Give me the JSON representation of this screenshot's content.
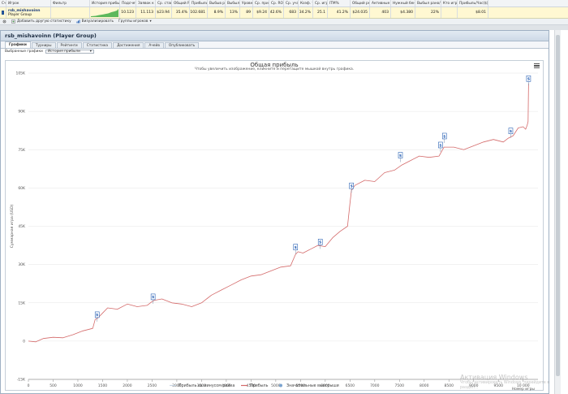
{
  "grid": {
    "headers": [
      "Сч.",
      "Игрок",
      "Фильтр",
      "История прибыли",
      "Подсчет",
      "Заявок к учас",
      "Ср. ставка",
      "Общий ROI",
      "Прибыль (",
      "Выбыв рано",
      "Выбыл поз",
      "Уровни",
      "Ср. прибыл",
      "Ср. ROI",
      "Ср. участ",
      "Коэф. тур",
      "Ср. игры ,",
      "ITM%",
      "Общий рейт",
      "Активные д",
      "Нужный бенкрол",
      "Выбыл рано/средне",
      "Кто играл",
      "Прибыль/Час($)"
    ],
    "row": {
      "player_name": "rsb_mishavoinn",
      "player_group": "Player Group",
      "values": [
        "10.123",
        "11.113",
        "$23.94",
        "35.4%",
        "$102.681",
        "8.9%",
        "13%",
        "89",
        "$9.24",
        "42.6%",
        "683",
        "34.2%",
        "25.1",
        "41.2%",
        "$24.035",
        "403",
        "$4.380",
        "22%",
        "",
        "$8.01"
      ]
    }
  },
  "toolbar": {
    "add_stats": "Добавить другую статистику",
    "visualize": "Визуализировать",
    "player_groups": "Группы игроков"
  },
  "panel": {
    "title": "rsb_mishavoinn (Player Group)",
    "tabs": [
      "Графики",
      "Турниры",
      "Рейтинги",
      "Статистика",
      "Достижения",
      "Ачейв",
      "Опубликовать"
    ],
    "selected_graph_label": "Выбранные графики",
    "selected_graph_value": "История прибыли"
  },
  "chart_data": {
    "type": "line",
    "title": "Общая прибыль",
    "subtitle": "Чтобы увеличить изображение, кликните и перетащите мышкой внутрь графика.",
    "ylabel": "Суммарная игра (USD)",
    "xlabel": "Номер игры",
    "xlim": [
      0,
      10300
    ],
    "ylim": [
      -15000,
      105000
    ],
    "x_ticks": [
      "0",
      "500",
      "1000",
      "1500",
      "2000",
      "2500",
      "3000",
      "3500",
      "4000",
      "4500",
      "5000",
      "5500",
      "6000",
      "6500",
      "7000",
      "7500",
      "8000",
      "8500",
      "9000",
      "9500",
      "10 000"
    ],
    "y_ticks": [
      "-15K",
      "0",
      "15K",
      "30K",
      "45K",
      "60K",
      "75K",
      "90K",
      "105K"
    ],
    "series": [
      {
        "name": "Прибыль",
        "color": "#d46a6a",
        "x": [
          0,
          150,
          300,
          500,
          700,
          900,
          1100,
          1300,
          1350,
          1400,
          1600,
          1800,
          2000,
          2200,
          2400,
          2500,
          2550,
          2700,
          2900,
          3100,
          3300,
          3500,
          3700,
          3900,
          4100,
          4300,
          4500,
          4700,
          4900,
          5100,
          5300,
          5400,
          5450,
          5550,
          5700,
          5850,
          6000,
          6150,
          6300,
          6450,
          6500,
          6530,
          6600,
          6800,
          7000,
          7200,
          7400,
          7550,
          7700,
          7900,
          8100,
          8300,
          8400,
          8600,
          8800,
          9000,
          9200,
          9400,
          9600,
          9700,
          9800,
          9900,
          10000,
          10050,
          10080,
          10100,
          10110
        ],
        "y": [
          0,
          -300,
          1000,
          1500,
          1300,
          2500,
          4000,
          5000,
          8500,
          9000,
          13000,
          12500,
          14500,
          13500,
          14000,
          15500,
          16000,
          16500,
          15000,
          14500,
          13500,
          15000,
          18000,
          20000,
          22000,
          24000,
          25500,
          26000,
          27500,
          29000,
          29500,
          34000,
          35000,
          34500,
          36000,
          37500,
          37000,
          40500,
          43000,
          45000,
          54000,
          59000,
          61000,
          63000,
          62500,
          66000,
          67000,
          69000,
          70500,
          72500,
          72000,
          72500,
          76000,
          76000,
          75000,
          76500,
          78000,
          79000,
          78000,
          79500,
          80500,
          83500,
          84000,
          83000,
          84500,
          86000,
          101000
        ]
      }
    ],
    "milestones": [
      {
        "x": 1390,
        "y": 10500
      },
      {
        "x": 2520,
        "y": 17500
      },
      {
        "x": 5400,
        "y": 37000
      },
      {
        "x": 5900,
        "y": 39000
      },
      {
        "x": 6530,
        "y": 61000
      },
      {
        "x": 7520,
        "y": 73000
      },
      {
        "x": 8330,
        "y": 77000
      },
      {
        "x": 8410,
        "y": 80500
      },
      {
        "x": 9750,
        "y": 82500
      },
      {
        "x": 10110,
        "y": 103000
      }
    ],
    "legend": [
      "Прибыль за минусом рейка",
      "Прибыль",
      "Значительные выигрыши"
    ],
    "legend_placement": "bottom",
    "grid": true
  },
  "watermark": {
    "line1": "Активация Windows",
    "line2": "Чтобы активировать Windows, перейдите в раздел..."
  },
  "colors": {
    "accent": "#2a62b5",
    "row_highlight": "#fff8d2",
    "profit_line": "#d46a6a",
    "milestone": "#2a62b5"
  }
}
